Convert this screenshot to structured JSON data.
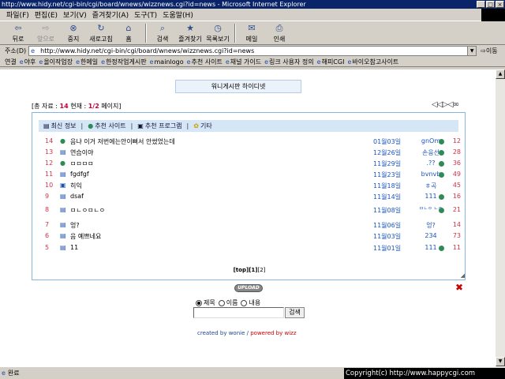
{
  "window": {
    "title": "http://www.hidy.net/cgi-bin/cgi/board/wnews/wizznews.cgi?id=news - Microsoft Internet Explorer"
  },
  "menu": [
    "파일(F)",
    "편집(E)",
    "보기(V)",
    "즐겨찾기(A)",
    "도구(T)",
    "도움말(H)"
  ],
  "toolbar": {
    "back": "뒤로",
    "forward": "앞으로",
    "stop": "중지",
    "refresh": "새로고침",
    "home": "홈",
    "search": "검색",
    "favorites": "즐겨찾기",
    "history": "목록보기",
    "mail": "메일",
    "print": "인쇄"
  },
  "address": {
    "label": "주소(D)",
    "url": "http://www.hidy.net/cgi-bin/cgi/board/wnews/wizznews.cgi?id=news",
    "go": "이동"
  },
  "links": {
    "label": "연결",
    "items": [
      "야후",
      "올이작업장",
      "한메일",
      "한정작업게시판",
      "mainlogo",
      "추천 사이트",
      "채널 가이드",
      "링크 사용자 정의",
      "해피CGI",
      "바이오참고사이트"
    ]
  },
  "board": {
    "title": "워니게시판 하이디넷",
    "info": {
      "total_prefix": "[총 자료 : ",
      "total": "14",
      "current_prefix": " 현재 : ",
      "current": "1/2",
      "pages_suffix": " 페이지]"
    },
    "tabs": [
      "최신 정보",
      "추천 사이트",
      "추천 프로그램",
      "기타"
    ],
    "rows": [
      {
        "no": "14",
        "title": "음냐 이거 저번에는안이뻐서 안썼었는데",
        "date": "01월03일",
        "author": "gnOm",
        "hits": "12"
      },
      {
        "no": "13",
        "title": "연습이야",
        "date": "12월26일",
        "author": "손웅선",
        "hits": "28"
      },
      {
        "no": "12",
        "title": "ㅁㅁㅁㅁ",
        "date": "11월29일",
        "author": ".??",
        "hits": "36"
      },
      {
        "no": "11",
        "title": "fgdfgf",
        "date": "11월23일",
        "author": "bvnvb",
        "hits": "49"
      },
      {
        "no": "10",
        "title": "히익",
        "date": "11월18일",
        "author": "ㅎ곡",
        "hits": "45"
      },
      {
        "no": "9",
        "title": "dsaf",
        "date": "11월14일",
        "author": "111",
        "hits": "16"
      },
      {
        "no": "8",
        "title": "ㅁㄴㅇㅁㄴㅇ",
        "date": "11월08일",
        "author": "ㅁㄴㅇ ㄴㅇ",
        "hits": "21"
      },
      {
        "no": "7",
        "title": "엉?",
        "date": "11월06일",
        "author": "엉?",
        "hits": "14"
      },
      {
        "no": "6",
        "title": "음 예쁘네요",
        "date": "11월03일",
        "author": "234",
        "hits": "73"
      },
      {
        "no": "5",
        "title": "11",
        "date": "11월01일",
        "author": "111",
        "hits": "11"
      }
    ],
    "pagination": {
      "top": "[top]",
      "p1": "[1]",
      "p2": "[2]"
    },
    "upload": "UPLOAD",
    "search": {
      "options": [
        "제목",
        "이름",
        "내용"
      ],
      "button": "검색"
    },
    "credit": {
      "a": "created by wonie",
      "sep": " / ",
      "b": "powered by wizz"
    }
  },
  "status": {
    "text": "완료"
  },
  "copyright": "Copyright(c) http://www.happycgi.com"
}
